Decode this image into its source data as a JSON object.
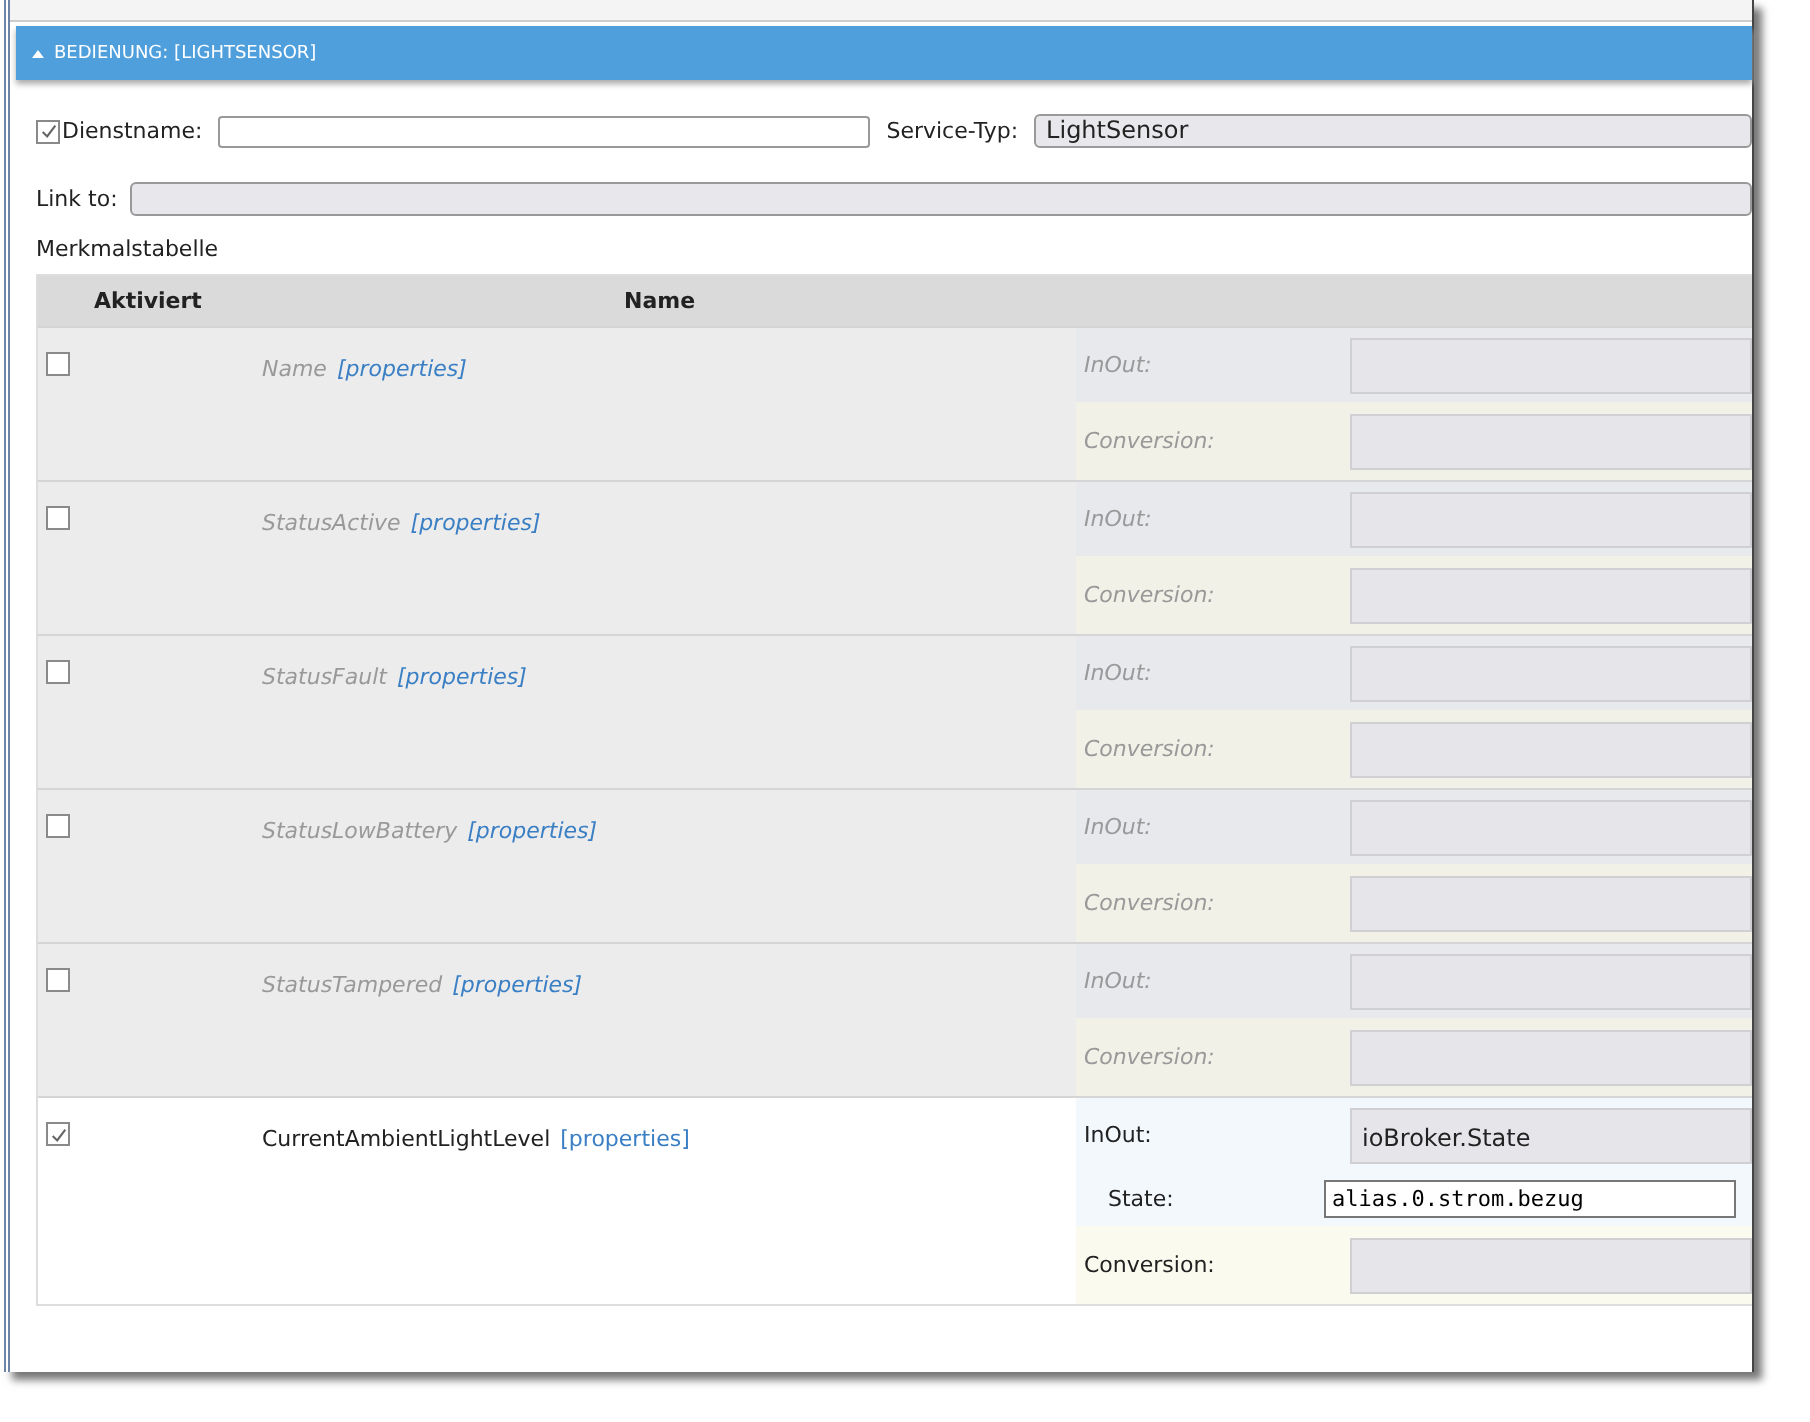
{
  "section": {
    "title": "BEDIENUNG: [LIGHTSENSOR]",
    "expanded": true
  },
  "service_name": {
    "checked": true,
    "label": "Dienstname:"
  },
  "service_type": {
    "label": "Service-Typ:",
    "value": "LightSensor"
  },
  "link_to": {
    "label": "Link to:"
  },
  "table_title": "Merkmalstabelle",
  "columns": [
    "Aktiviert",
    "Name"
  ],
  "characteristics": [
    {
      "checked": false,
      "name": "Name",
      "link": "[properties]",
      "fields": [
        {
          "kind": "select",
          "label": "InOut:"
        },
        {
          "kind": "conversion",
          "label": "Conversion:"
        }
      ]
    },
    {
      "checked": false,
      "name": "StatusActive",
      "link": "[properties]",
      "fields": [
        {
          "kind": "select",
          "label": "InOut:"
        },
        {
          "kind": "conversion",
          "label": "Conversion:"
        }
      ]
    },
    {
      "checked": false,
      "name": "StatusFault",
      "link": "[properties]",
      "fields": [
        {
          "kind": "select",
          "label": "InOut:"
        },
        {
          "kind": "conversion",
          "label": "Conversion:"
        }
      ]
    },
    {
      "checked": false,
      "name": "StatusLowBattery",
      "link": "[properties]",
      "fields": [
        {
          "kind": "select",
          "label": "InOut:"
        },
        {
          "kind": "conversion",
          "label": "Conversion:"
        }
      ]
    },
    {
      "checked": false,
      "name": "StatusTampered",
      "link": "[properties]",
      "fields": [
        {
          "kind": "select",
          "label": "InOut:"
        },
        {
          "kind": "conversion",
          "label": "Conversion:"
        }
      ]
    },
    {
      "checked": true,
      "name": "CurrentAmbientLightLevel",
      "link": "[properties]",
      "fields": [
        {
          "kind": "select",
          "label": "InOut:",
          "value": "ioBroker.State"
        },
        {
          "kind": "text",
          "label": "State:",
          "value": "alias.0.strom.bezug"
        },
        {
          "kind": "conversion",
          "label": "Conversion:"
        }
      ]
    }
  ]
}
